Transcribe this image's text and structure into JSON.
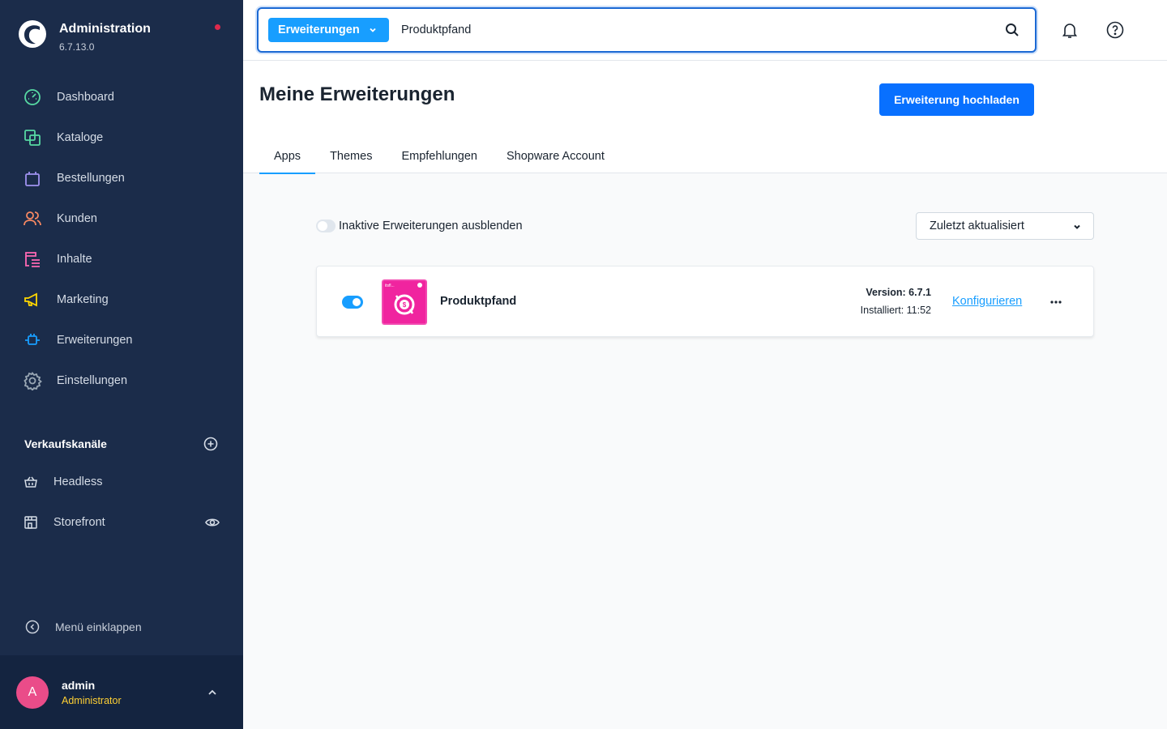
{
  "sidebar": {
    "brand_title": "Administration",
    "brand_version": "6.7.13.0",
    "nav": [
      {
        "label": "Dashboard",
        "icon": "gauge-icon",
        "color": "#57d9a3"
      },
      {
        "label": "Kataloge",
        "icon": "products-icon",
        "color": "#57d9a3"
      },
      {
        "label": "Bestellungen",
        "icon": "shopping-bag-icon",
        "color": "#a092f0"
      },
      {
        "label": "Kunden",
        "icon": "users-icon",
        "color": "#f88962"
      },
      {
        "label": "Inhalte",
        "icon": "content-icon",
        "color": "#ff68b4"
      },
      {
        "label": "Marketing",
        "icon": "megaphone-icon",
        "color": "#ffd700"
      },
      {
        "label": "Erweiterungen",
        "icon": "plug-icon",
        "color": "#189eff"
      },
      {
        "label": "Einstellungen",
        "icon": "gear-icon",
        "color": "#9aa8b5"
      }
    ],
    "sales_channels_title": "Verkaufskanäle",
    "sales_channels": [
      {
        "label": "Headless",
        "icon": "basket-icon"
      },
      {
        "label": "Storefront",
        "icon": "storefront-icon"
      }
    ],
    "collapse_label": "Menü einklappen",
    "user": {
      "initial": "A",
      "name": "admin",
      "role": "Administrator"
    }
  },
  "topbar": {
    "search_type": "Erweiterungen",
    "search_value": "Produktpfand"
  },
  "page": {
    "title": "Meine Erweiterungen",
    "upload_button": "Erweiterung hochladen",
    "tabs": [
      "Apps",
      "Themes",
      "Empfehlungen",
      "Shopware Account"
    ],
    "active_tab": "Apps"
  },
  "filters": {
    "hide_inactive_label": "Inaktive Erweiterungen ausblenden",
    "sort_value": "Zuletzt aktualisiert"
  },
  "extension": {
    "name": "Produktpfand",
    "version": "Version: 6.7.1",
    "installed": "Installiert: 11:52",
    "configure_label": "Konfigurieren",
    "active": true,
    "icon_color": "#f0249f",
    "icon_text": "itsfl..."
  },
  "colors": {
    "sidebar_bg": "#1b2c4a",
    "primary": "#189eff",
    "button": "#0870ff"
  }
}
